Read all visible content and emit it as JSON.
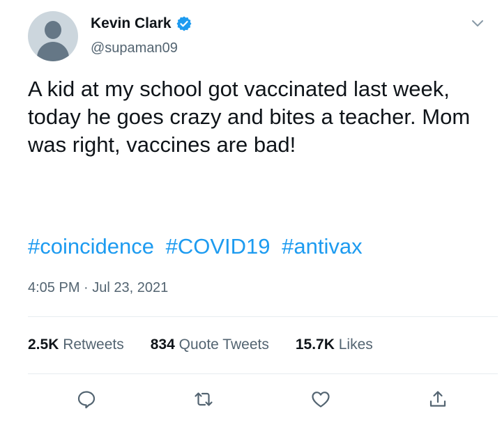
{
  "author": {
    "display_name": "Kevin Clark",
    "handle": "@supaman09",
    "verified": true
  },
  "tweet": {
    "text": "A kid at my school got vaccinated last week, today he goes crazy and bites a teacher. Mom was right, vaccines are bad!",
    "hashtags": [
      "#coincidence",
      "#COVID19",
      "#antivax"
    ]
  },
  "meta": {
    "time": "4:05 PM",
    "separator": "·",
    "date": "Jul 23, 2021"
  },
  "stats": {
    "retweets": {
      "count": "2.5K",
      "label": "Retweets"
    },
    "quote_tweets": {
      "count": "834",
      "label": "Quote Tweets"
    },
    "likes": {
      "count": "15.7K",
      "label": "Likes"
    }
  },
  "icons": {
    "reply": "speech-bubble-icon",
    "retweet": "retweet-arrows-icon",
    "like": "heart-icon",
    "share": "share-upload-icon",
    "more": "chevron-down-icon",
    "verified": "verified-badge-icon"
  },
  "colors": {
    "accent": "#1d9bf0",
    "text": "#0f1419",
    "secondary": "#536471",
    "divider": "#e6ecf0"
  }
}
